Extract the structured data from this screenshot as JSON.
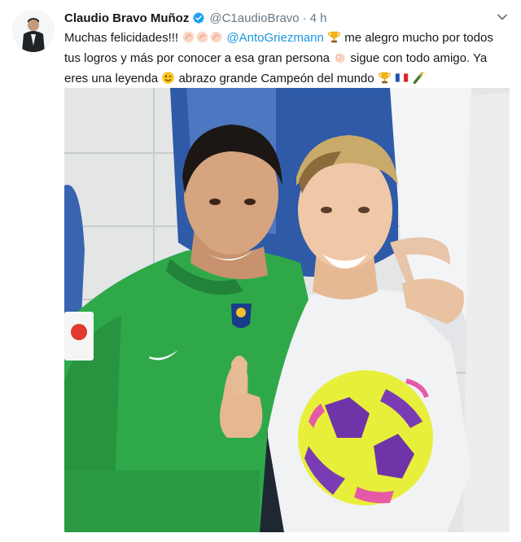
{
  "tweet": {
    "author_name": "Claudio Bravo Muñoz",
    "handle": "@C1audioBravo",
    "separator": "·",
    "time": "4 h",
    "text": {
      "line1_start": "Muchas felicidades!!!",
      "mention": "@AntoGriezmann",
      "line1_end": " me alegro mucho por todos",
      "line2_start": "tus logros y más por conocer a esa gran persona",
      "line2_end": " sigue con todo amigo. Ya",
      "line3_start": "eres una leyenda",
      "line3_mid": " abrazo grande Campeón del mundo"
    }
  },
  "colors": {
    "link": "#1b95e0",
    "verified": "#1da1f2",
    "muted": "#657786",
    "green_shirt": "#2fa84a",
    "ball": "#e8ef3a"
  },
  "icons": [
    "verified-icon",
    "chevron-down-icon",
    "clap-emoji",
    "trophy-emoji",
    "ok-hand-emoji",
    "wink-emoji",
    "france-flag-emoji",
    "champagne-emoji"
  ]
}
